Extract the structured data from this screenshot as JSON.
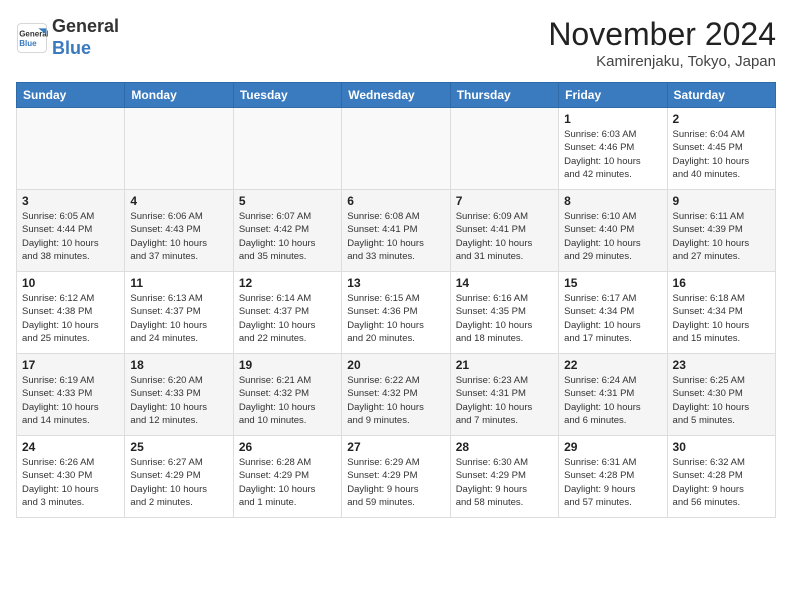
{
  "header": {
    "logo_line1": "General",
    "logo_line2": "Blue",
    "month": "November 2024",
    "location": "Kamirenjaku, Tokyo, Japan"
  },
  "weekdays": [
    "Sunday",
    "Monday",
    "Tuesday",
    "Wednesday",
    "Thursday",
    "Friday",
    "Saturday"
  ],
  "weeks": [
    [
      {
        "day": "",
        "info": ""
      },
      {
        "day": "",
        "info": ""
      },
      {
        "day": "",
        "info": ""
      },
      {
        "day": "",
        "info": ""
      },
      {
        "day": "",
        "info": ""
      },
      {
        "day": "1",
        "info": "Sunrise: 6:03 AM\nSunset: 4:46 PM\nDaylight: 10 hours\nand 42 minutes."
      },
      {
        "day": "2",
        "info": "Sunrise: 6:04 AM\nSunset: 4:45 PM\nDaylight: 10 hours\nand 40 minutes."
      }
    ],
    [
      {
        "day": "3",
        "info": "Sunrise: 6:05 AM\nSunset: 4:44 PM\nDaylight: 10 hours\nand 38 minutes."
      },
      {
        "day": "4",
        "info": "Sunrise: 6:06 AM\nSunset: 4:43 PM\nDaylight: 10 hours\nand 37 minutes."
      },
      {
        "day": "5",
        "info": "Sunrise: 6:07 AM\nSunset: 4:42 PM\nDaylight: 10 hours\nand 35 minutes."
      },
      {
        "day": "6",
        "info": "Sunrise: 6:08 AM\nSunset: 4:41 PM\nDaylight: 10 hours\nand 33 minutes."
      },
      {
        "day": "7",
        "info": "Sunrise: 6:09 AM\nSunset: 4:41 PM\nDaylight: 10 hours\nand 31 minutes."
      },
      {
        "day": "8",
        "info": "Sunrise: 6:10 AM\nSunset: 4:40 PM\nDaylight: 10 hours\nand 29 minutes."
      },
      {
        "day": "9",
        "info": "Sunrise: 6:11 AM\nSunset: 4:39 PM\nDaylight: 10 hours\nand 27 minutes."
      }
    ],
    [
      {
        "day": "10",
        "info": "Sunrise: 6:12 AM\nSunset: 4:38 PM\nDaylight: 10 hours\nand 25 minutes."
      },
      {
        "day": "11",
        "info": "Sunrise: 6:13 AM\nSunset: 4:37 PM\nDaylight: 10 hours\nand 24 minutes."
      },
      {
        "day": "12",
        "info": "Sunrise: 6:14 AM\nSunset: 4:37 PM\nDaylight: 10 hours\nand 22 minutes."
      },
      {
        "day": "13",
        "info": "Sunrise: 6:15 AM\nSunset: 4:36 PM\nDaylight: 10 hours\nand 20 minutes."
      },
      {
        "day": "14",
        "info": "Sunrise: 6:16 AM\nSunset: 4:35 PM\nDaylight: 10 hours\nand 18 minutes."
      },
      {
        "day": "15",
        "info": "Sunrise: 6:17 AM\nSunset: 4:34 PM\nDaylight: 10 hours\nand 17 minutes."
      },
      {
        "day": "16",
        "info": "Sunrise: 6:18 AM\nSunset: 4:34 PM\nDaylight: 10 hours\nand 15 minutes."
      }
    ],
    [
      {
        "day": "17",
        "info": "Sunrise: 6:19 AM\nSunset: 4:33 PM\nDaylight: 10 hours\nand 14 minutes."
      },
      {
        "day": "18",
        "info": "Sunrise: 6:20 AM\nSunset: 4:33 PM\nDaylight: 10 hours\nand 12 minutes."
      },
      {
        "day": "19",
        "info": "Sunrise: 6:21 AM\nSunset: 4:32 PM\nDaylight: 10 hours\nand 10 minutes."
      },
      {
        "day": "20",
        "info": "Sunrise: 6:22 AM\nSunset: 4:32 PM\nDaylight: 10 hours\nand 9 minutes."
      },
      {
        "day": "21",
        "info": "Sunrise: 6:23 AM\nSunset: 4:31 PM\nDaylight: 10 hours\nand 7 minutes."
      },
      {
        "day": "22",
        "info": "Sunrise: 6:24 AM\nSunset: 4:31 PM\nDaylight: 10 hours\nand 6 minutes."
      },
      {
        "day": "23",
        "info": "Sunrise: 6:25 AM\nSunset: 4:30 PM\nDaylight: 10 hours\nand 5 minutes."
      }
    ],
    [
      {
        "day": "24",
        "info": "Sunrise: 6:26 AM\nSunset: 4:30 PM\nDaylight: 10 hours\nand 3 minutes."
      },
      {
        "day": "25",
        "info": "Sunrise: 6:27 AM\nSunset: 4:29 PM\nDaylight: 10 hours\nand 2 minutes."
      },
      {
        "day": "26",
        "info": "Sunrise: 6:28 AM\nSunset: 4:29 PM\nDaylight: 10 hours\nand 1 minute."
      },
      {
        "day": "27",
        "info": "Sunrise: 6:29 AM\nSunset: 4:29 PM\nDaylight: 9 hours\nand 59 minutes."
      },
      {
        "day": "28",
        "info": "Sunrise: 6:30 AM\nSunset: 4:29 PM\nDaylight: 9 hours\nand 58 minutes."
      },
      {
        "day": "29",
        "info": "Sunrise: 6:31 AM\nSunset: 4:28 PM\nDaylight: 9 hours\nand 57 minutes."
      },
      {
        "day": "30",
        "info": "Sunrise: 6:32 AM\nSunset: 4:28 PM\nDaylight: 9 hours\nand 56 minutes."
      }
    ]
  ]
}
